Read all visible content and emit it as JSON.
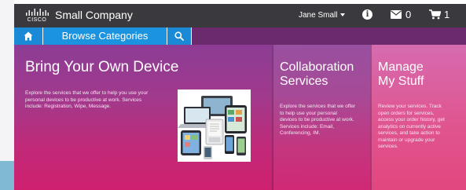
{
  "header": {
    "logo_text": "CISCO",
    "company_name": "Small Company",
    "user_name": "Jane Small",
    "info_icon": "info-icon",
    "mail_icon": "envelope-icon",
    "mail_count": "0",
    "cart_icon": "cart-icon",
    "cart_count": "1"
  },
  "nav": {
    "home_icon": "home-icon",
    "browse_label": "Browse Categories",
    "search_icon": "search-icon"
  },
  "hero": {
    "title": "Bring Your Own Device",
    "description": "Explore the services that we offer to help you use your personal devices to be productive at work. Services include: Registration, Wipe, Message."
  },
  "collaboration": {
    "title_line1": "Collaboration",
    "title_line2": "Services",
    "description": "Explore the services that we offer to help use your personal devices to be productive at work. Services include: Email, Conferencing, IM."
  },
  "manage": {
    "title_line1": "Manage",
    "title_line2": "My Stuff",
    "description": "Review your services. Track open orders for services, access your order history, get analytics on currently active services, and take action to maintain or upgrade your services."
  },
  "colors": {
    "header_bg": "#3a3a3e",
    "nav_blue": "#1c93de",
    "hero_purple": "#8c3c95",
    "hero_magenta": "#cf2070",
    "manage_pink": "#e0558f"
  }
}
